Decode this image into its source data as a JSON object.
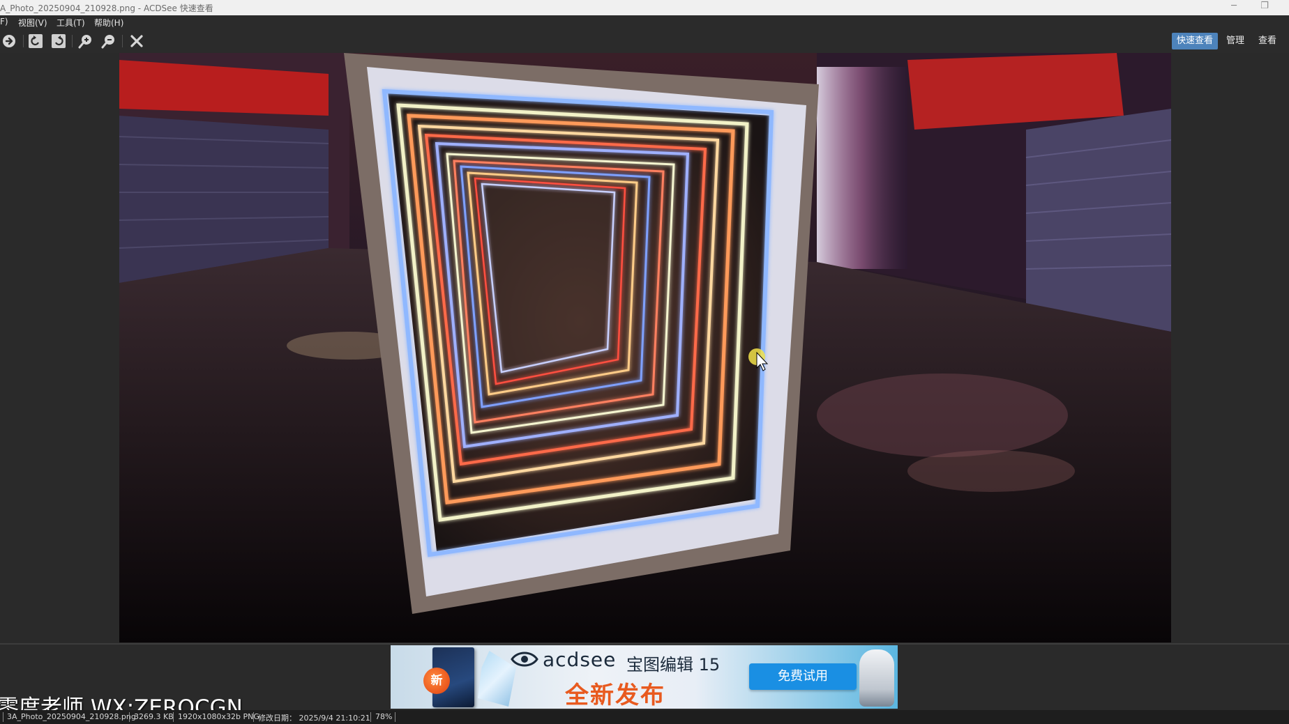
{
  "window": {
    "title": "A_Photo_20250904_210928.png - ACDSee 快速查看",
    "minimize_glyph": "─",
    "restore_glyph": "❐"
  },
  "menu": {
    "items": [
      "F)",
      "视图(V)",
      "工具(T)",
      "帮助(H)"
    ]
  },
  "toolbar": {
    "icons": [
      "next-arrow-icon",
      "rotate-left-icon",
      "rotate-right-icon",
      "zoom-in-icon",
      "zoom-out-icon",
      "close-x-icon"
    ],
    "modes": [
      "快速查看",
      "管理",
      "查看"
    ],
    "active_mode": "快速查看",
    "accent_color": "#4d83bb"
  },
  "image": {
    "subject": "neon-light-frame-on-street"
  },
  "ad": {
    "brand": "acdsee",
    "product": "宝图编辑 15",
    "tagline": "全新发布",
    "badge": "新",
    "cta": "免费试用"
  },
  "watermark": {
    "text": "零度老师 WX:ZEROCGN"
  },
  "status": {
    "filename": "3A_Photo_20250904_210928.png",
    "filesize": "3269.3 KB",
    "dimensions": "1920x1080x32b PNG",
    "modified": "修改日期： 2025/9/4 21:10:21",
    "zoom": "78%"
  }
}
